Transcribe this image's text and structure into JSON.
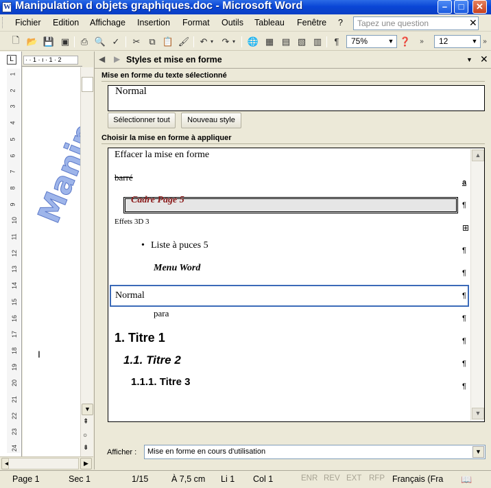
{
  "window": {
    "title": "Manipulation d objets graphiques.doc - Microsoft Word",
    "app_icon": "word-doc-icon"
  },
  "menubar": {
    "items": [
      "Fichier",
      "Edition",
      "Affichage",
      "Insertion",
      "Format",
      "Outils",
      "Tableau",
      "Fenêtre",
      "?"
    ],
    "help_placeholder": "Tapez une question"
  },
  "toolbar": {
    "zoom": "75%",
    "font_size": "12",
    "pilcrow": "¶"
  },
  "ruler": {
    "horizontal_text": "· · 1 · ı · 1 · 2",
    "vertical_numbers": [
      "1",
      "2",
      "3",
      "4",
      "5",
      "6",
      "7",
      "8",
      "9",
      "10",
      "11",
      "12",
      "13",
      "14",
      "15",
      "16",
      "17",
      "18",
      "19",
      "20",
      "21",
      "22",
      "23",
      "24"
    ]
  },
  "taskpane": {
    "title": "Styles et mise en forme",
    "section_selected": "Mise en forme du texte sélectionné",
    "selected_style": "Normal",
    "btn_select_all": "Sélectionner tout",
    "btn_new_style": "Nouveau style",
    "section_apply": "Choisir la mise en forme à appliquer",
    "styles": [
      {
        "label": "Effacer la mise en forme",
        "mark": ""
      },
      {
        "label": "barré",
        "mark": "a"
      },
      {
        "label": "Cadre Page 5",
        "mark": "¶"
      },
      {
        "label": "Effets 3D 3",
        "mark": "⊞"
      },
      {
        "label": "Liste à puces 5",
        "mark": "¶"
      },
      {
        "label": "Menu Word",
        "mark": "¶"
      },
      {
        "label": "Normal",
        "mark": "¶"
      },
      {
        "label": "para",
        "mark": "¶"
      },
      {
        "label": "1.  Titre 1",
        "mark": "¶"
      },
      {
        "label": "1.1.  Titre 2",
        "mark": "¶"
      },
      {
        "label": "1.1.1.  Titre 3",
        "mark": "¶"
      }
    ],
    "afficher_label": "Afficher :",
    "afficher_value": "Mise en forme en cours d'utilisation"
  },
  "statusbar": {
    "page": "Page 1",
    "sec": "Sec 1",
    "pages": "1/15",
    "at": "À 7,5 cm",
    "line": "Li 1",
    "col": "Col 1",
    "enr": "ENR",
    "rev": "REV",
    "ext": "EXT",
    "rfp": "RFP",
    "language": "Français (Fra"
  },
  "colors": {
    "titlebar": "#0a46d6",
    "selection_border": "#3b6ab8",
    "cadre_text": "#8b1a1a",
    "wordart": "#6f8fd8"
  }
}
